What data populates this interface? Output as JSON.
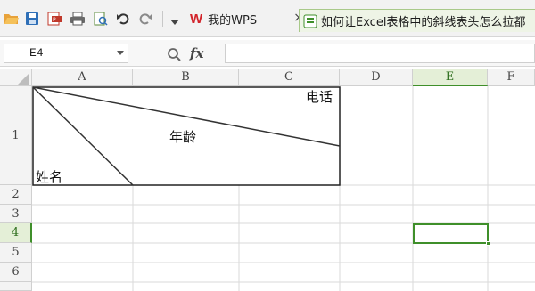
{
  "toolbar": {
    "wps_tab_label": "我的WPS",
    "wps_logo": "W",
    "close_label": "×",
    "doc_tab_label": "如何让Excel表格中的斜线表头怎么拉都"
  },
  "formula_bar": {
    "name_box_value": "E4",
    "fx_label": "fx",
    "formula_value": ""
  },
  "sheet": {
    "columns": [
      "A",
      "B",
      "C",
      "D",
      "E",
      "F"
    ],
    "rows": [
      "1",
      "2",
      "3",
      "4",
      "5",
      "6"
    ],
    "active_column": "E",
    "active_row": "4",
    "header_cell": {
      "top_right": "电话",
      "middle": "年龄",
      "bottom_left": "姓名"
    }
  },
  "colors": {
    "accent_green": "#3f8f2a",
    "wps_red": "#d2232a"
  },
  "icons": [
    "open-folder-icon",
    "save-icon",
    "export-pdf-icon",
    "print-icon",
    "print-preview-icon",
    "undo-icon",
    "redo-icon",
    "more-dropdown-icon",
    "wps-logo-icon",
    "document-icon",
    "zoom-icon",
    "fx-icon"
  ]
}
